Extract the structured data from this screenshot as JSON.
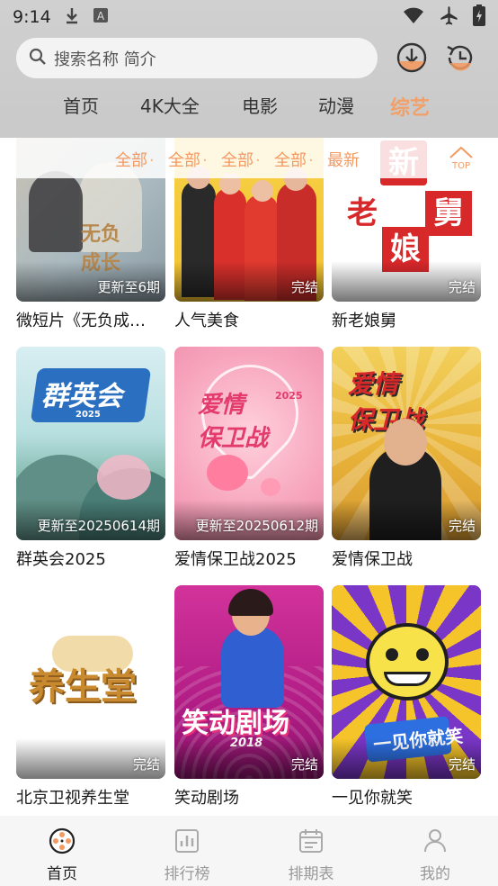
{
  "status_bar": {
    "time": "9:14"
  },
  "search": {
    "placeholder": "搜索名称 简介"
  },
  "tabs": [
    {
      "label": "首页"
    },
    {
      "label": "4K大全"
    },
    {
      "label": "电影"
    },
    {
      "label": "动漫"
    },
    {
      "label": "综艺"
    }
  ],
  "filters": [
    {
      "label": "全部"
    },
    {
      "label": "全部"
    },
    {
      "label": "全部"
    },
    {
      "label": "全部"
    },
    {
      "label": "最新"
    }
  ],
  "filter_separator": "·",
  "top_button": {
    "label": "TOP"
  },
  "items": [
    {
      "title": "微短片《无负成…",
      "badge": "更新至6期",
      "poster": "无负成长"
    },
    {
      "title": "人气美食",
      "badge": "完结",
      "poster": ""
    },
    {
      "title": "新老娘舅",
      "badge": "完结",
      "poster": "新老娘舅"
    },
    {
      "title": "群英会2025",
      "badge": "更新至20250614期",
      "poster": "群英会"
    },
    {
      "title": "爱情保卫战2025",
      "badge": "更新至20250612期",
      "poster": "爱情保卫战"
    },
    {
      "title": "爱情保卫战",
      "badge": "完结",
      "poster": "爱情保卫战"
    },
    {
      "title": "北京卫视养生堂",
      "badge": "完结",
      "poster": "养生堂"
    },
    {
      "title": "笑动剧场",
      "badge": "完结",
      "poster": "笑动剧场"
    },
    {
      "title": "一见你就笑",
      "badge": "完结",
      "poster": "一见你就笑"
    }
  ],
  "bottom_nav": [
    {
      "label": "首页",
      "icon": "film-reel-icon"
    },
    {
      "label": "排行榜",
      "icon": "chart-icon"
    },
    {
      "label": "排期表",
      "icon": "calendar-icon"
    },
    {
      "label": "我的",
      "icon": "user-icon"
    }
  ],
  "colors": {
    "accent": "#f39a62",
    "header_bg": "#cccccc"
  }
}
